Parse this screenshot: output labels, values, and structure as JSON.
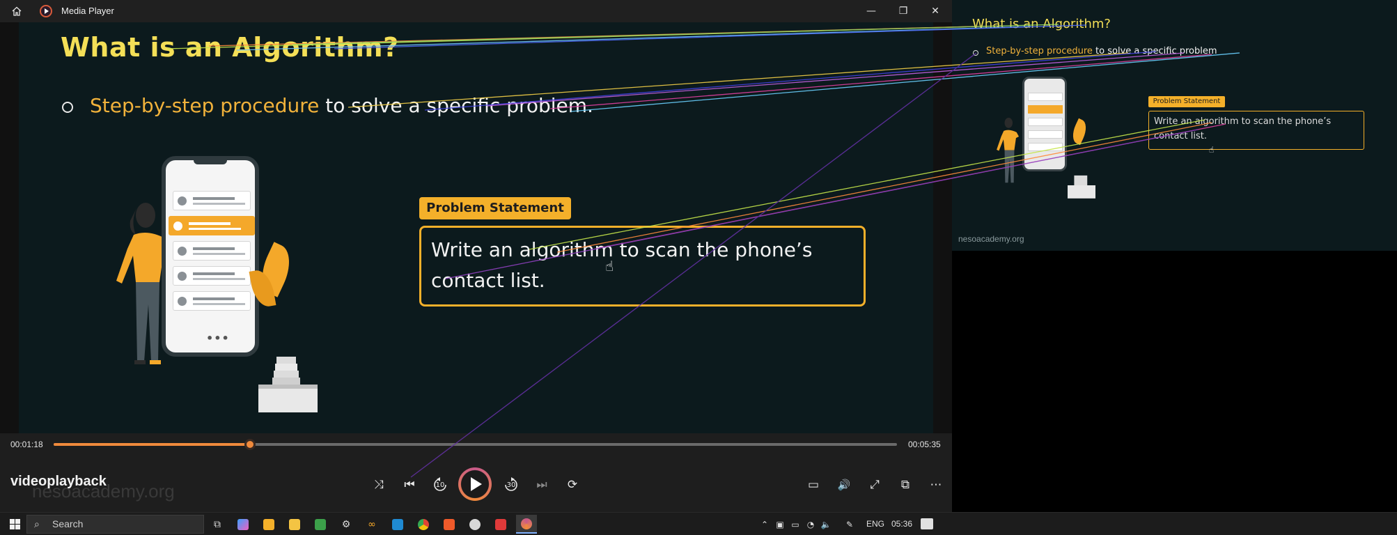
{
  "window": {
    "title": "Media Player",
    "minimize": "—",
    "maximize": "❐",
    "close": "✕"
  },
  "slide": {
    "title": "What is an Algorithm?",
    "bullet_highlight": "Step-by-step procedure",
    "bullet_rest": " to solve a specific problem.",
    "problem_label": "Problem Statement",
    "problem_text": "Write an algorithm to scan the phone’s contact list."
  },
  "player": {
    "time_current": "00:01:18",
    "time_total": "00:05:35",
    "progress_fraction": 0.2328,
    "media_title": "videoplayback",
    "watermark": "nesoacademy.org",
    "controls": {
      "shuffle": "⤨",
      "previous": "⏮",
      "rewind_10": "10",
      "forward_30": "30",
      "next": "⏭",
      "repeat": "⟳",
      "subtitles": "▭",
      "volume": "🔊",
      "fullscreen": "⤢",
      "mini_player": "⧉",
      "more": "⋯"
    }
  },
  "preview": {
    "title": "What is an Algorithm?",
    "bullet_highlight": "Step-by-step procedure",
    "bullet_rest": " to solve a specific problem",
    "problem_label": "Problem Statement",
    "problem_text": "Write an algorithm to scan the phone’s contact list.",
    "footer": "nesoacademy.org"
  },
  "taskbar": {
    "search_placeholder": "Search",
    "language": "ENG",
    "clock": "05:36"
  },
  "colors": {
    "accent_orange": "#f08a3c",
    "slide_yellow": "#f4df57",
    "problem_gold": "#f4b02a",
    "slide_bg": "#0c1a1d"
  }
}
